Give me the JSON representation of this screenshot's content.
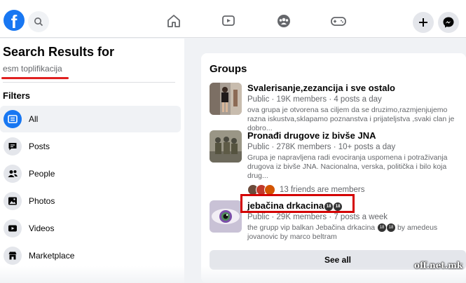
{
  "topbar": {
    "logo": "f",
    "icons": [
      "search-icon",
      "home-icon",
      "watch-icon",
      "groups-icon",
      "gaming-icon",
      "plus-icon",
      "messenger-icon"
    ]
  },
  "sidebar": {
    "title": "Search Results for",
    "query": "esm toplifikacija",
    "filters_label": "Filters",
    "filters": [
      {
        "label": "All",
        "icon": "feed-icon",
        "active": true
      },
      {
        "label": "Posts",
        "icon": "posts-icon",
        "active": false
      },
      {
        "label": "People",
        "icon": "people-icon",
        "active": false
      },
      {
        "label": "Photos",
        "icon": "photos-icon",
        "active": false
      },
      {
        "label": "Videos",
        "icon": "videos-icon",
        "active": false
      },
      {
        "label": "Marketplace",
        "icon": "marketplace-icon",
        "active": false
      }
    ]
  },
  "main": {
    "groups_title": "Groups",
    "groups": [
      {
        "name": "Svalerisanje,zezancija i sve ostalo",
        "meta": "Public · 19K members · 4 posts a day",
        "desc": "ova grupa je otvorena sa ciljem da se druzimo,razmjenjujemo razna iskustva,sklapamo poznanstva i prijateljstva ,svaki clan je dobro..."
      },
      {
        "name": "Pronađi drugove iz bivše JNA",
        "meta": "Public · 278K members · 10+ posts a day",
        "desc": "Grupa je napravljena radi evociranja uspomena i potraživanja drugova iz bivše JNA. Nacionalna, verska, politička i bilo koja drug...",
        "friends": "13 friends are members"
      },
      {
        "name": "jebačina drkacina",
        "name_badges": "18",
        "meta": "Public · 29K members · 7 posts a week",
        "desc_a": "the grupp vip balkan Jebačina drkacina",
        "desc_b": "by amedeus jovanovic by marco beltram"
      }
    ],
    "see_all": "See all"
  },
  "watermark": "off.net.mk",
  "colors": {
    "accent": "#1877f2",
    "highlight": "#d40000"
  }
}
